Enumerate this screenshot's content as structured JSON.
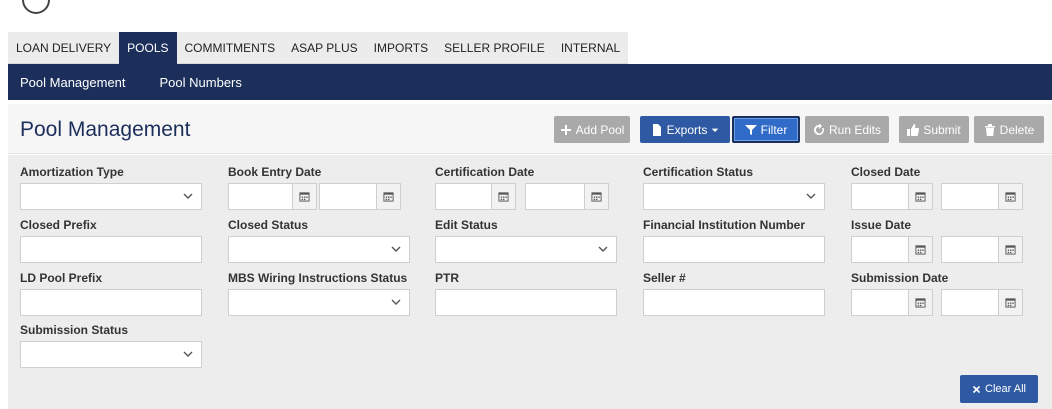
{
  "tabs": [
    {
      "label": "LOAN DELIVERY",
      "active": false
    },
    {
      "label": "POOLS",
      "active": true
    },
    {
      "label": "COMMITMENTS",
      "active": false
    },
    {
      "label": "ASAP PLUS",
      "active": false
    },
    {
      "label": "IMPORTS",
      "active": false
    },
    {
      "label": "SELLER PROFILE",
      "active": false
    },
    {
      "label": "INTERNAL",
      "active": false
    }
  ],
  "subnav": {
    "pool_management": "Pool Management",
    "pool_numbers": "Pool Numbers"
  },
  "page": {
    "title": "Pool Management"
  },
  "toolbar": {
    "add_pool": "Add Pool",
    "exports": "Exports",
    "filter": "Filter",
    "run_edits": "Run Edits",
    "submit": "Submit",
    "delete": "Delete"
  },
  "filters": {
    "amortization_type": "Amortization Type",
    "book_entry_date": "Book Entry Date",
    "certification_date": "Certification Date",
    "certification_status": "Certification Status",
    "closed_date": "Closed Date",
    "closed_prefix": "Closed Prefix",
    "closed_status": "Closed Status",
    "edit_status": "Edit Status",
    "financial_institution_number": "Financial Institution Number",
    "issue_date": "Issue Date",
    "ld_pool_prefix": "LD Pool Prefix",
    "mbs_wiring_instructions_status": "MBS Wiring Instructions Status",
    "ptr": "PTR",
    "seller_number": "Seller #",
    "submission_date": "Submission Date",
    "submission_status": "Submission Status"
  },
  "clear_all": "Clear All",
  "colors": {
    "navy": "#1c2f5b",
    "primary": "#2f5aa3",
    "disabled": "#a9a9a9"
  }
}
